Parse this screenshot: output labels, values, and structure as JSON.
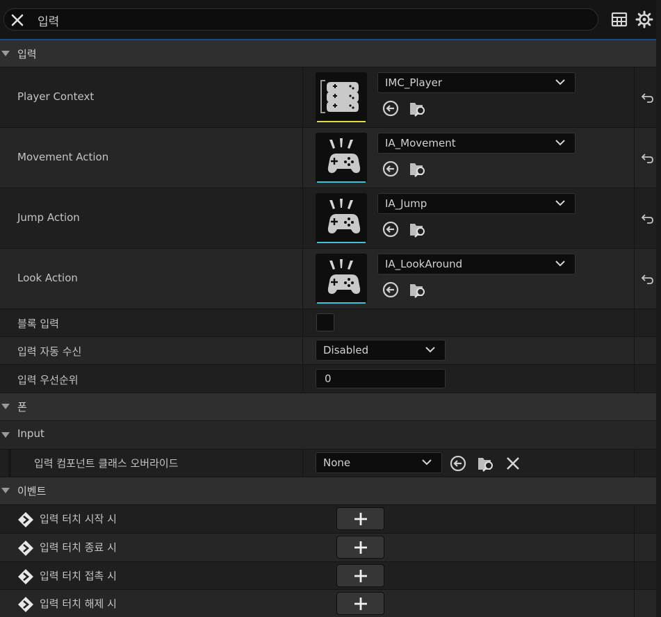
{
  "search": {
    "query": "입력"
  },
  "categories": {
    "input": "입력",
    "pawn": "폰",
    "input_sub": "Input",
    "events": "이벤트"
  },
  "mappings": [
    {
      "label": "Player Context",
      "value": "IMC_Player",
      "bar_color": "#e6d94a",
      "icon": "mapping-context-icon"
    },
    {
      "label": "Movement Action",
      "value": "IA_Movement",
      "bar_color": "#3fc4d6",
      "icon": "input-action-icon"
    },
    {
      "label": "Jump Action",
      "value": "IA_Jump",
      "bar_color": "#3fc4d6",
      "icon": "input-action-icon"
    },
    {
      "label": "Look Action",
      "value": "IA_LookAround",
      "bar_color": "#3fc4d6",
      "icon": "input-action-icon"
    }
  ],
  "block_input": {
    "label": "블록 입력"
  },
  "auto_receive": {
    "label": "입력 자동 수신",
    "value": "Disabled"
  },
  "priority": {
    "label": "입력 우선순위",
    "value": "0"
  },
  "component_override": {
    "label": "입력 컴포넌트 클래스 오버라이드",
    "value": "None"
  },
  "events": [
    {
      "label": "입력 터치 시작 시"
    },
    {
      "label": "입력 터치 종료 시"
    },
    {
      "label": "입력 터치 접촉 시"
    },
    {
      "label": "입력 터치 해제 시"
    }
  ]
}
